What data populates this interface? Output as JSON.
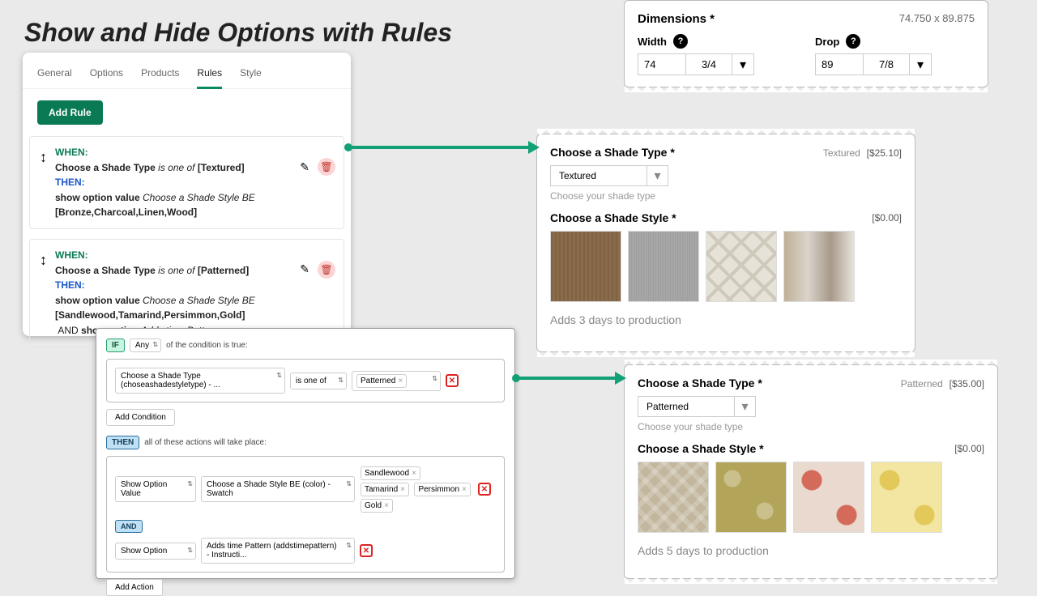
{
  "title": "Show and Hide Options with Rules",
  "tabs": [
    "General",
    "Options",
    "Products",
    "Rules",
    "Style"
  ],
  "active_tab": "Rules",
  "add_rule": "Add Rule",
  "rule1": {
    "when": "WHEN:",
    "cond_pre": "Choose a Shade Type",
    "cond_mid": "is one of",
    "cond_val": "[Textured]",
    "then": "THEN:",
    "act_pre": "show option value",
    "act_mid": "Choose a Shade Style BE",
    "act_val": "[Bronze,Charcoal,Linen,Wood]"
  },
  "rule2": {
    "when": "WHEN:",
    "cond_pre": "Choose a Shade Type",
    "cond_mid": "is one of",
    "cond_val": "[Patterned]",
    "then": "THEN:",
    "act_pre": "show option value",
    "act_mid": "Choose a Shade Style BE",
    "act_val": "[Sandlewood,Tamarind,Persimmon,Gold]",
    "and": "AND",
    "act2_pre": "show option",
    "act2_mid": "Adds time Pattern"
  },
  "editor": {
    "if": "IF",
    "any": "Any",
    "any_tail": "of the condition is true:",
    "cond_field": "Choose a Shade Type (choseashadestyletype) - ...",
    "cond_op": "is one of",
    "cond_tag": "Patterned",
    "add_cond": "Add Condition",
    "then": "THEN",
    "then_tail": "all of these actions will take place:",
    "act1_type": "Show Option Value",
    "act1_field": "Choose a Shade Style BE (color) - Swatch",
    "act1_tags": [
      "Sandlewood",
      "Tamarind",
      "Persimmon",
      "Gold"
    ],
    "and": "AND",
    "act2_type": "Show Option",
    "act2_field": "Adds time Pattern (addstimepattern) - Instructi...",
    "add_action": "Add Action"
  },
  "dimensions": {
    "title": "Dimensions *",
    "readout": "74.750 x 89.875",
    "width_label": "Width",
    "drop_label": "Drop",
    "width_int": "74",
    "width_frac": "3/4",
    "drop_int": "89",
    "drop_frac": "7/8"
  },
  "preview1": {
    "type_label": "Choose a Shade Type *",
    "type_meta": "Textured",
    "type_price": "[$25.10]",
    "type_value": "Textured",
    "type_hint": "Choose your shade type",
    "style_label": "Choose a Shade Style *",
    "style_price": "[$0.00]",
    "days": "Adds 3 days to production"
  },
  "preview2": {
    "type_label": "Choose a Shade Type *",
    "type_meta": "Patterned",
    "type_price": "[$35.00]",
    "type_value": "Patterned",
    "type_hint": "Choose your shade type",
    "style_label": "Choose a Shade Style *",
    "style_price": "[$0.00]",
    "days": "Adds 5 days to production"
  }
}
